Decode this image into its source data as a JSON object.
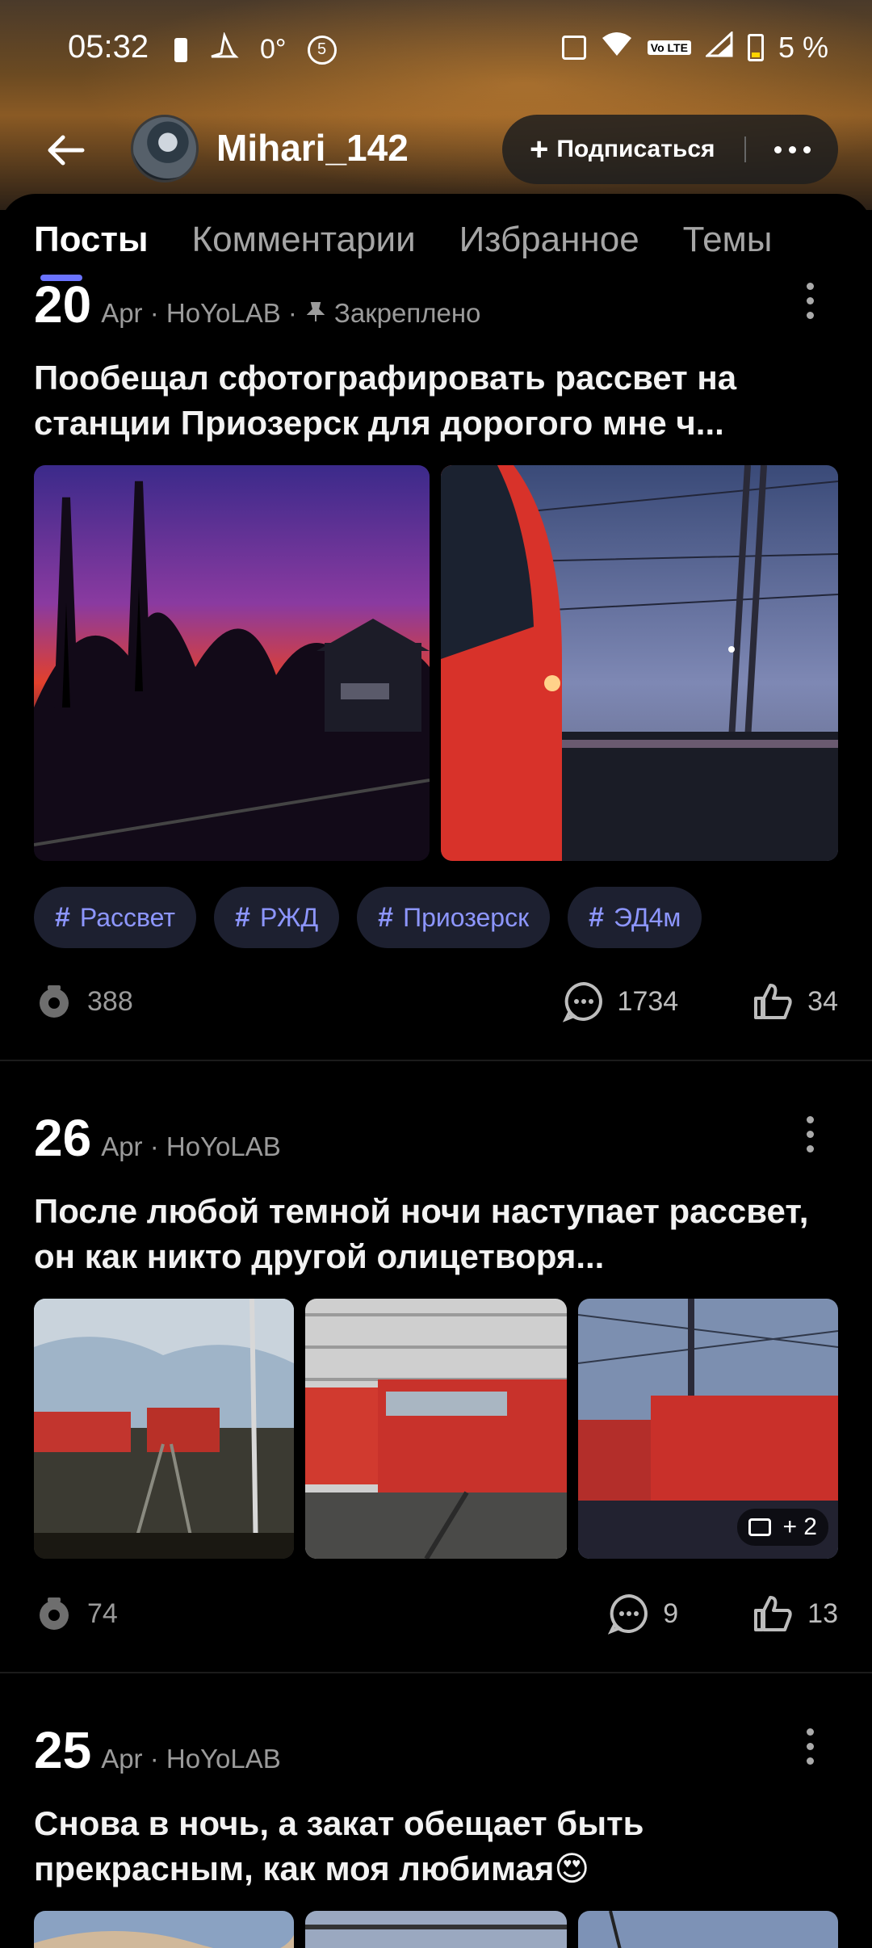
{
  "status_bar": {
    "time": "05:32",
    "temperature": "0°",
    "notif_count": "5",
    "battery_text": "5 %",
    "volte": "Vo LTE"
  },
  "header": {
    "username": "Mihari_142",
    "follow_label": "Подписаться"
  },
  "tabs": [
    "Посты",
    "Комментарии",
    "Избранное",
    "Темы"
  ],
  "posts": [
    {
      "day": "20",
      "meta": "Apr · HoYoLAB ·",
      "pinned": "Закреплено",
      "title": "Пообещал сфотографировать рассвет на станции Приозерск для дорогого мне ч...",
      "tags": [
        "Рассвет",
        "РЖД",
        "Приозерск",
        "ЭД4м"
      ],
      "views": "388",
      "comments": "1734",
      "likes": "34"
    },
    {
      "day": "26",
      "meta": "Apr · HoYoLAB",
      "title": "После любой темной ночи наступает рассвет, он как никто другой олицетворя...",
      "more_images": "+ 2",
      "views": "74",
      "comments": "9",
      "likes": "13"
    },
    {
      "day": "25",
      "meta": "Apr · HoYoLAB",
      "title": "Снова в ночь, а закат обещает быть прекрасным, как моя любимая😍"
    }
  ],
  "icons": [
    "back-arrow-icon",
    "plus-icon",
    "more-dots-icon",
    "pin-icon",
    "hash-icon",
    "views-eye-icon",
    "comment-icon",
    "like-thumb-icon",
    "image-stack-icon"
  ],
  "colors": {
    "accent": "#6a73ff",
    "tag_text": "#8d96ff",
    "tag_bg": "#1d2030"
  }
}
